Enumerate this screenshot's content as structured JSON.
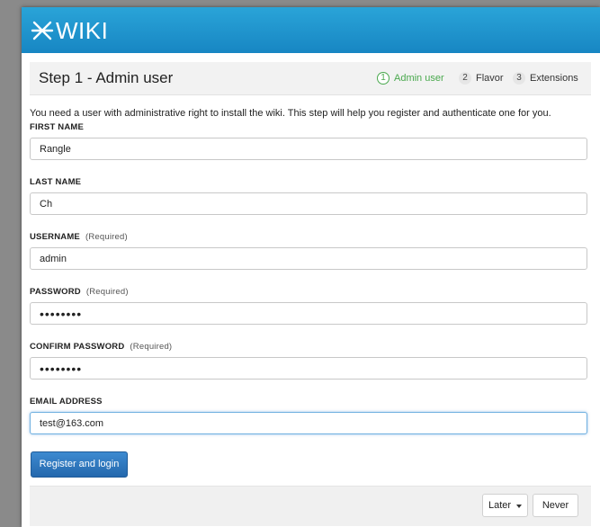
{
  "app": {
    "logo_text": "WIKI",
    "accent": "#1f8fcc"
  },
  "stepbar": {
    "title": "Step 1 - Admin user",
    "steps": [
      {
        "num": "1",
        "label": "Admin user",
        "active": true
      },
      {
        "num": "2",
        "label": "Flavor",
        "active": false
      },
      {
        "num": "3",
        "label": "Extensions",
        "active": false
      }
    ]
  },
  "intro": "You need a user with administrative right to install the wiki. This step will help you register and authenticate one for you.",
  "form": {
    "first_name": {
      "label": "FIRST NAME",
      "value": "Rangle"
    },
    "last_name": {
      "label": "LAST NAME",
      "value": "Ch"
    },
    "username": {
      "label": "USERNAME",
      "required": "(Required)",
      "value": "admin"
    },
    "password": {
      "label": "PASSWORD",
      "required": "(Required)",
      "value": "••••••••"
    },
    "confirm_password": {
      "label": "CONFIRM PASSWORD",
      "required": "(Required)",
      "value": "••••••••"
    },
    "email": {
      "label": "EMAIL ADDRESS",
      "value": "test@163.com"
    }
  },
  "buttons": {
    "register": "Register and login",
    "later": "Later",
    "never": "Never"
  }
}
